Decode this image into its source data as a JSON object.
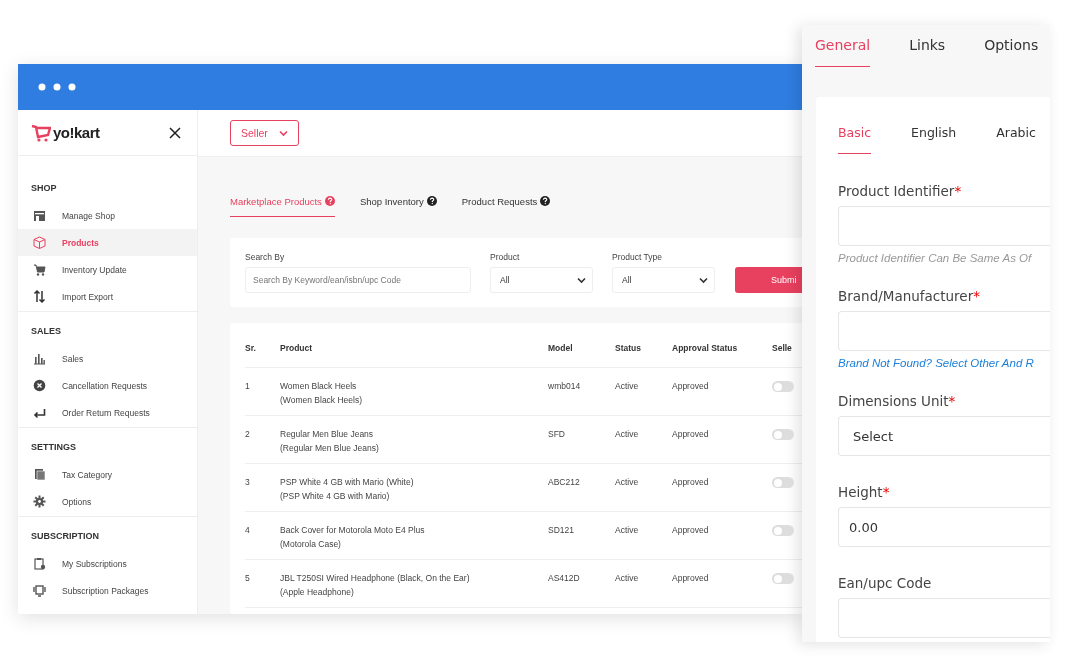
{
  "window": {
    "logo": "yo!kart"
  },
  "sidebar": {
    "sections": [
      {
        "title": "SHOP",
        "items": [
          {
            "label": "Manage Shop",
            "selected": false
          },
          {
            "label": "Products",
            "selected": true
          },
          {
            "label": "Inventory Update",
            "selected": false
          },
          {
            "label": "Import Export",
            "selected": false
          }
        ]
      },
      {
        "title": "SALES",
        "items": [
          {
            "label": "Sales",
            "selected": false
          },
          {
            "label": "Cancellation Requests",
            "selected": false
          },
          {
            "label": "Order Return Requests",
            "selected": false
          }
        ]
      },
      {
        "title": "SETTINGS",
        "items": [
          {
            "label": "Tax Category",
            "selected": false
          },
          {
            "label": "Options",
            "selected": false
          }
        ]
      },
      {
        "title": "SUBSCRIPTION",
        "items": [
          {
            "label": "My Subscriptions",
            "selected": false
          },
          {
            "label": "Subscription Packages",
            "selected": false
          }
        ]
      }
    ]
  },
  "role_dropdown": {
    "value": "Seller"
  },
  "tabs": [
    {
      "label": "Marketplace Products",
      "selected": true
    },
    {
      "label": "Shop Inventory",
      "selected": false
    },
    {
      "label": "Product Requests",
      "selected": false
    }
  ],
  "filters": {
    "search": {
      "label": "Search By",
      "placeholder": "Search By Keyword/ean/isbn/upc Code"
    },
    "selects": [
      {
        "label": "Product",
        "value": "All"
      },
      {
        "label": "Product Type",
        "value": "All"
      }
    ],
    "submit": "Submi"
  },
  "table": {
    "columns": [
      "Sr.",
      "Product",
      "Model",
      "Status",
      "Approval Status",
      "Selle"
    ],
    "rows": [
      {
        "sr": "1",
        "product": "Women Black Heels",
        "subtitle": "(Women Black Heels)",
        "model": "wmb014",
        "status": "Active",
        "approval": "Approved",
        "on": false
      },
      {
        "sr": "2",
        "product": "Regular Men Blue Jeans",
        "subtitle": "(Regular Men Blue Jeans)",
        "model": "SFD",
        "status": "Active",
        "approval": "Approved",
        "on": false
      },
      {
        "sr": "3",
        "product": "PSP White 4 GB with Mario (White)",
        "subtitle": "(PSP White 4 GB with Mario)",
        "model": "ABC212",
        "status": "Active",
        "approval": "Approved",
        "on": false
      },
      {
        "sr": "4",
        "product": "Back Cover for Motorola Moto E4 Plus",
        "subtitle": "(Motorola Case)",
        "model": "SD121",
        "status": "Active",
        "approval": "Approved",
        "on": false
      },
      {
        "sr": "5",
        "product": "JBL T250SI Wired Headphone (Black, On the Ear)",
        "subtitle": "(Apple Headphone)",
        "model": "AS412D",
        "status": "Active",
        "approval": "Approved",
        "on": false
      }
    ]
  },
  "panel": {
    "tabs": [
      {
        "label": "General",
        "selected": true
      },
      {
        "label": "Links",
        "selected": false
      },
      {
        "label": "Options",
        "selected": false
      }
    ],
    "subtabs": [
      {
        "label": "Basic",
        "selected": true
      },
      {
        "label": "English",
        "selected": false
      },
      {
        "label": "Arabic",
        "selected": false
      }
    ],
    "fields": [
      {
        "kind": "input",
        "label": "Product Identifier",
        "required_mark": "*",
        "hint": "Product Identifier Can Be Same As Of"
      },
      {
        "kind": "input",
        "label": "Brand/Manufacturer",
        "required_mark": "*",
        "link": "Brand Not Found? Select Other And R"
      },
      {
        "kind": "select",
        "label": "Dimensions Unit",
        "required_mark": "*",
        "value": "Select"
      },
      {
        "kind": "input",
        "label": "Height",
        "required_mark": "*",
        "value": "0.00"
      },
      {
        "kind": "input",
        "label": "Ean/upc Code"
      }
    ]
  }
}
